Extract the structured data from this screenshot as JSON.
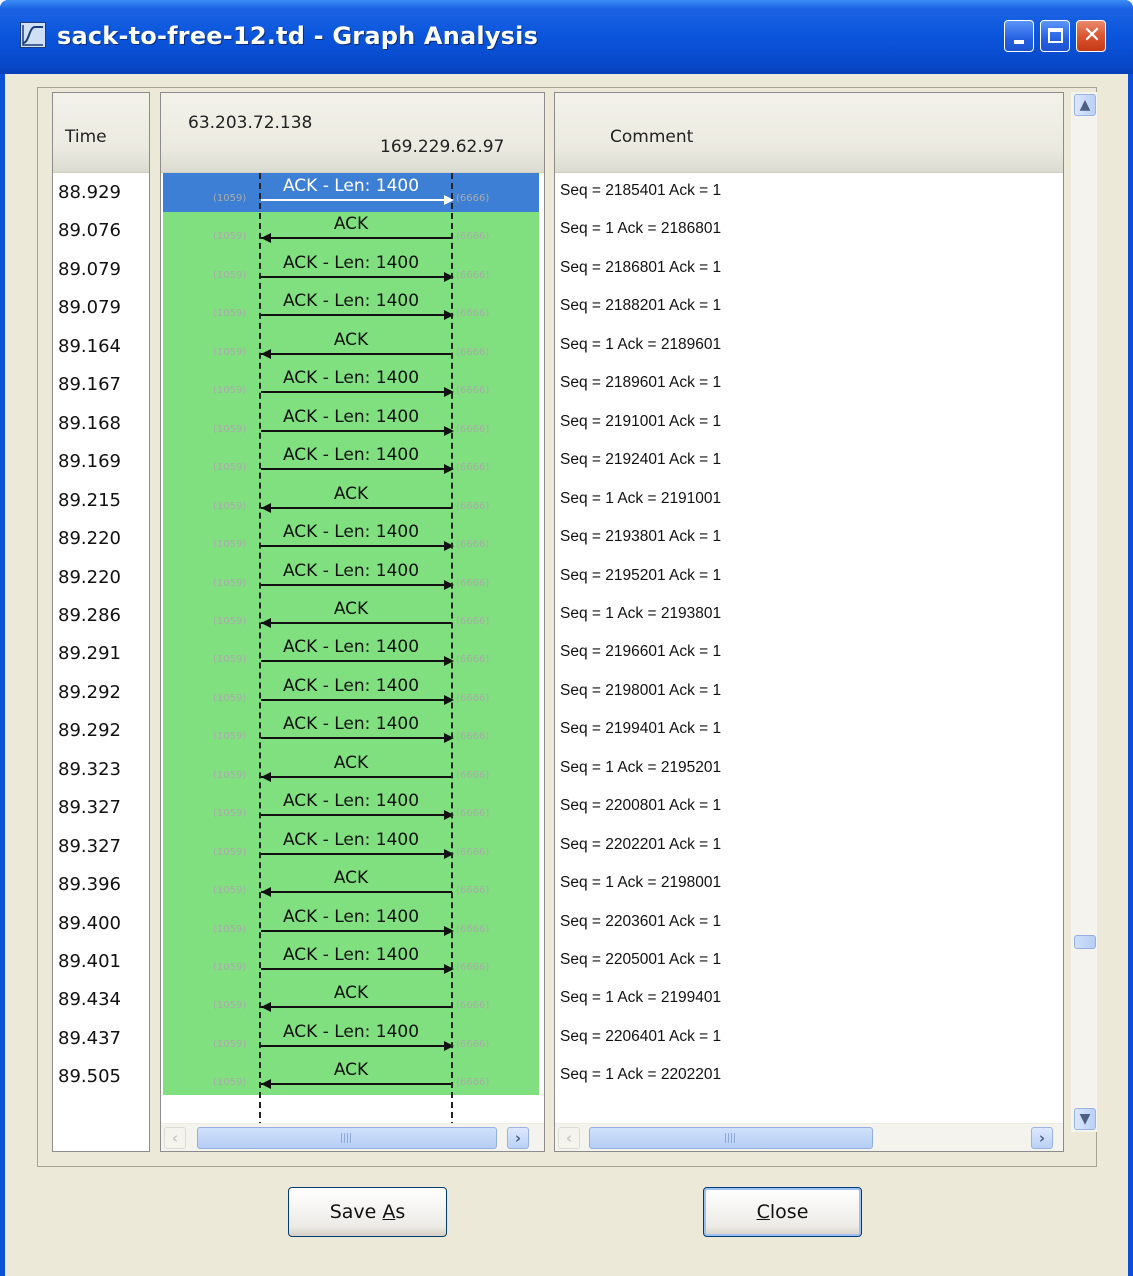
{
  "window": {
    "title": "sack-to-free-12.td - Graph Analysis"
  },
  "columns": {
    "time_header": "Time",
    "comment_header": "Comment",
    "node_a": "63.203.72.138",
    "node_b": "169.229.62.97"
  },
  "ports": {
    "left": "(1059)",
    "right": "(6666)"
  },
  "rows": [
    {
      "time": "88.929",
      "label": "ACK - Len: 1400",
      "dir": "right",
      "comment": "Seq = 2185401 Ack = 1",
      "selected": true
    },
    {
      "time": "89.076",
      "label": "ACK",
      "dir": "left",
      "comment": "Seq = 1 Ack = 2186801"
    },
    {
      "time": "89.079",
      "label": "ACK - Len: 1400",
      "dir": "right",
      "comment": "Seq = 2186801 Ack = 1"
    },
    {
      "time": "89.079",
      "label": "ACK - Len: 1400",
      "dir": "right",
      "comment": "Seq = 2188201 Ack = 1"
    },
    {
      "time": "89.164",
      "label": "ACK",
      "dir": "left",
      "comment": "Seq = 1 Ack = 2189601"
    },
    {
      "time": "89.167",
      "label": "ACK - Len: 1400",
      "dir": "right",
      "comment": "Seq = 2189601 Ack = 1"
    },
    {
      "time": "89.168",
      "label": "ACK - Len: 1400",
      "dir": "right",
      "comment": "Seq = 2191001 Ack = 1"
    },
    {
      "time": "89.169",
      "label": "ACK - Len: 1400",
      "dir": "right",
      "comment": "Seq = 2192401 Ack = 1"
    },
    {
      "time": "89.215",
      "label": "ACK",
      "dir": "left",
      "comment": "Seq = 1 Ack = 2191001"
    },
    {
      "time": "89.220",
      "label": "ACK - Len: 1400",
      "dir": "right",
      "comment": "Seq = 2193801 Ack = 1"
    },
    {
      "time": "89.220",
      "label": "ACK - Len: 1400",
      "dir": "right",
      "comment": "Seq = 2195201 Ack = 1"
    },
    {
      "time": "89.286",
      "label": "ACK",
      "dir": "left",
      "comment": "Seq = 1 Ack = 2193801"
    },
    {
      "time": "89.291",
      "label": "ACK - Len: 1400",
      "dir": "right",
      "comment": "Seq = 2196601 Ack = 1"
    },
    {
      "time": "89.292",
      "label": "ACK - Len: 1400",
      "dir": "right",
      "comment": "Seq = 2198001 Ack = 1"
    },
    {
      "time": "89.292",
      "label": "ACK - Len: 1400",
      "dir": "right",
      "comment": "Seq = 2199401 Ack = 1"
    },
    {
      "time": "89.323",
      "label": "ACK",
      "dir": "left",
      "comment": "Seq = 1 Ack = 2195201"
    },
    {
      "time": "89.327",
      "label": "ACK - Len: 1400",
      "dir": "right",
      "comment": "Seq = 2200801 Ack = 1"
    },
    {
      "time": "89.327",
      "label": "ACK - Len: 1400",
      "dir": "right",
      "comment": "Seq = 2202201 Ack = 1"
    },
    {
      "time": "89.396",
      "label": "ACK",
      "dir": "left",
      "comment": "Seq = 1 Ack = 2198001"
    },
    {
      "time": "89.400",
      "label": "ACK - Len: 1400",
      "dir": "right",
      "comment": "Seq = 2203601 Ack = 1"
    },
    {
      "time": "89.401",
      "label": "ACK - Len: 1400",
      "dir": "right",
      "comment": "Seq = 2205001 Ack = 1"
    },
    {
      "time": "89.434",
      "label": "ACK",
      "dir": "left",
      "comment": "Seq = 1 Ack = 2199401"
    },
    {
      "time": "89.437",
      "label": "ACK - Len: 1400",
      "dir": "right",
      "comment": "Seq = 2206401 Ack = 1"
    },
    {
      "time": "89.505",
      "label": "ACK",
      "dir": "left",
      "comment": "Seq = 1 Ack = 2202201"
    }
  ],
  "buttons": {
    "save_as_prefix": "Save ",
    "save_as_key": "A",
    "save_as_suffix": "s",
    "close_key": "C",
    "close_suffix": "lose"
  },
  "icons": {
    "app": "graph-icon",
    "minimize": "minimize-icon",
    "maximize": "maximize-icon",
    "close": "close-icon",
    "scroll_up": "arrow-up-icon",
    "scroll_down": "arrow-down-icon",
    "scroll_left": "arrow-left-icon",
    "scroll_right": "arrow-right-icon"
  },
  "colors": {
    "flow_background": "#80e080",
    "selected_row": "#3c7fd4"
  }
}
